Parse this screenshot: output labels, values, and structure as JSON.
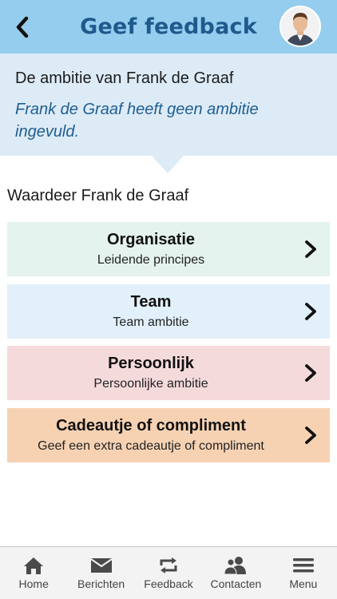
{
  "header": {
    "title": "Geef feedback",
    "back_icon": "chevron-left-icon",
    "avatar": "user-avatar"
  },
  "ambition": {
    "heading": "De ambitie van Frank de Graaf",
    "text": "Frank de Graaf heeft geen ambitie ingevuld."
  },
  "section_label": "Waardeer Frank de Graaf",
  "cards": [
    {
      "title": "Organisatie",
      "subtitle": "Leidende principes",
      "color": "#e4f3ee"
    },
    {
      "title": "Team",
      "subtitle": "Team ambitie",
      "color": "#e1f0fa"
    },
    {
      "title": "Persoonlijk",
      "subtitle": "Persoonlijke ambitie",
      "color": "#f5dadc"
    },
    {
      "title": "Cadeautje of compliment",
      "subtitle": "Geef een extra cadeautje of compliment",
      "color": "#f6d2b3"
    }
  ],
  "tabs": [
    {
      "label": "Home",
      "icon": "home-icon"
    },
    {
      "label": "Berichten",
      "icon": "mail-icon"
    },
    {
      "label": "Feedback",
      "icon": "repeat-icon"
    },
    {
      "label": "Contacten",
      "icon": "contacts-icon"
    },
    {
      "label": "Menu",
      "icon": "menu-icon"
    }
  ],
  "colors": {
    "header_bg": "#95cdee",
    "title": "#1e5a8c",
    "ambition_bg": "#ddebf7",
    "ambition_text": "#1f5e90"
  }
}
